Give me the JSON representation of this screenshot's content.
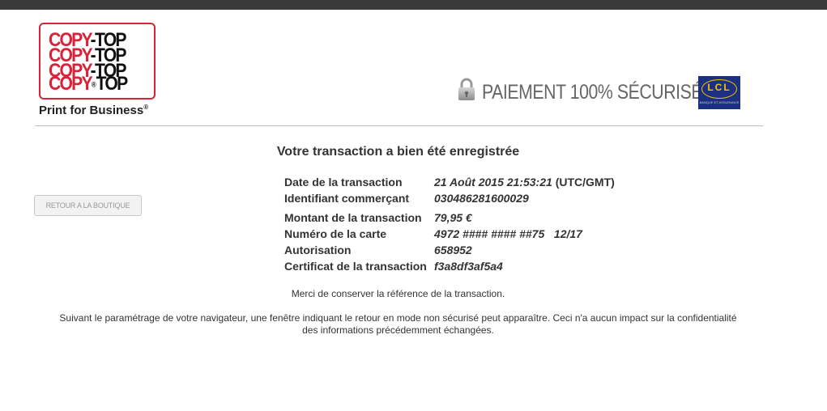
{
  "logo": {
    "brand_part1": "COPY",
    "brand_part2": "TOP",
    "registered": "®",
    "tagline": "Print for Business",
    "tagline_mark": "®"
  },
  "secure": {
    "icon": "lock-icon",
    "text": "PAIEMENT 100% SÉCURISÉ",
    "bank_logo_text": "LCL",
    "bank_logo_subtext": "BANQUE ET ASSURANCE"
  },
  "page": {
    "title": "Votre transaction a bien été enregistrée",
    "back_button": "RETOUR A LA BOUTIQUE"
  },
  "transaction": {
    "date_label": "Date de la transaction",
    "date_value": "21 Août 2015 21:53:21",
    "date_tz": "(UTC/GMT)",
    "merchant_label": "Identifiant commerçant",
    "merchant_value": "030486281600029",
    "amount_label": "Montant de la transaction",
    "amount_value": "79,95 €",
    "card_label": "Numéro de la carte",
    "card_value": "4972 #### #### ##75   12/17",
    "auth_label": "Autorisation",
    "auth_value": "658952",
    "cert_label": "Certificat de la transaction",
    "cert_value": "f3a8df3af5a4"
  },
  "messages": {
    "thanks": "Merci de conserver la référence de la transaction.",
    "notice": "Suivant le paramétrage de votre navigateur, une fenêtre indiquant le retour en mode non sécurisé peut apparaître. Ceci n'a aucun impact sur la confidentialité des informations précédemment échangées."
  },
  "colors": {
    "brand_red": "#d8233a",
    "lcl_blue": "#1c2f80",
    "lcl_yellow": "#f2c400"
  }
}
